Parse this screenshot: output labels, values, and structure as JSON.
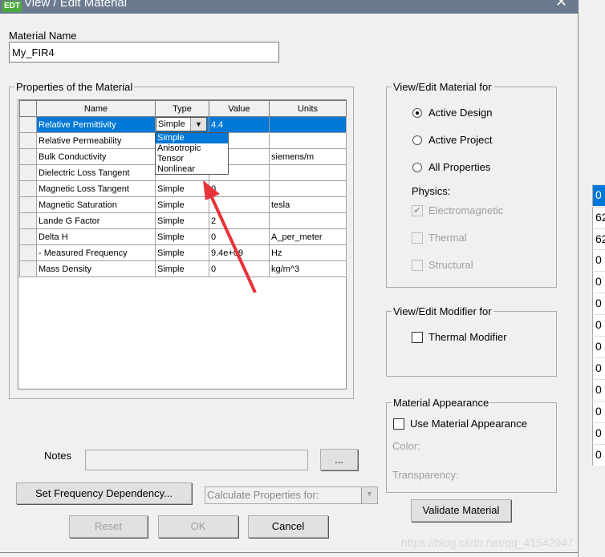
{
  "window": {
    "title": "View / Edit Material",
    "icon_text": "EDT"
  },
  "material_name": {
    "label": "Material Name",
    "value": "My_FIR4"
  },
  "properties": {
    "legend": "Properties of the Material",
    "columns": [
      "Name",
      "Type",
      "Value",
      "Units"
    ],
    "rows": [
      {
        "name": "Relative Permittivity",
        "type": "Simple",
        "value": "4.4",
        "units": "",
        "selected": true
      },
      {
        "name": "Relative Permeability",
        "type": "",
        "value": "",
        "units": ""
      },
      {
        "name": "Bulk Conductivity",
        "type": "",
        "value": "",
        "units": "siemens/m"
      },
      {
        "name": "Dielectric Loss Tangent",
        "type": "",
        "value": "",
        "units": ""
      },
      {
        "name": "Magnetic Loss Tangent",
        "type": "Simple",
        "value": "0",
        "units": ""
      },
      {
        "name": "Magnetic Saturation",
        "type": "Simple",
        "value": "",
        "units": "tesla"
      },
      {
        "name": "Lande G Factor",
        "type": "Simple",
        "value": "2",
        "units": ""
      },
      {
        "name": "Delta H",
        "type": "Simple",
        "value": "0",
        "units": "A_per_meter"
      },
      {
        "name": "- Measured Frequency",
        "type": "Simple",
        "value": "9.4e+09",
        "units": "Hz"
      },
      {
        "name": "Mass Density",
        "type": "Simple",
        "value": "0",
        "units": "kg/m^3"
      }
    ],
    "type_dropdown": {
      "selected": "Simple",
      "options": [
        "Simple",
        "Anisotropic",
        "Tensor",
        "Nonlinear"
      ]
    }
  },
  "view_edit_for": {
    "legend": "View/Edit Material for",
    "options": [
      "Active Design",
      "Active Project",
      "All Properties"
    ],
    "selected": "Active Design",
    "physics_label": "Physics:",
    "physics": [
      {
        "label": "Electromagnetic",
        "checked": true
      },
      {
        "label": "Thermal",
        "checked": false
      },
      {
        "label": "Structural",
        "checked": false
      }
    ]
  },
  "modifier": {
    "legend": "View/Edit Modifier for",
    "thermal_modifier": "Thermal Modifier"
  },
  "appearance": {
    "legend": "Material Appearance",
    "use": "Use Material Appearance",
    "color": "Color:",
    "transparency": "Transparency:"
  },
  "notes": {
    "label": "Notes",
    "browse": "..."
  },
  "buttons": {
    "set_freq": "Set Frequency Dependency...",
    "calc_placeholder": "Calculate Properties for:",
    "validate": "Validate Material",
    "reset": "Reset",
    "ok": "OK",
    "cancel": "Cancel"
  },
  "background_values": [
    "0",
    "62",
    "62",
    "0",
    "0",
    "0",
    "0",
    "0",
    "0",
    "0",
    "0",
    "0",
    "0"
  ],
  "watermark": "https://blog.csdn.net/qq_41542947",
  "colors": {
    "selection": "#0078d7",
    "titlebar": "#6b7a8f",
    "arrow": "#e8333a"
  }
}
